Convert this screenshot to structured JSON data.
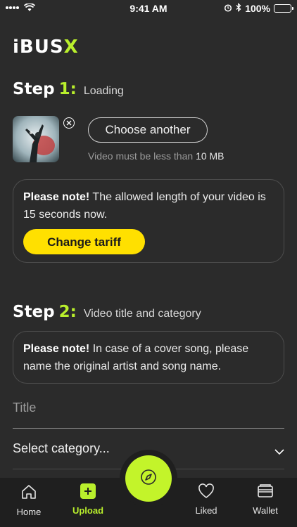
{
  "status_bar": {
    "time": "9:41 AM",
    "battery": "100%"
  },
  "logo": {
    "main": "iBUS",
    "accent": "X"
  },
  "step1": {
    "word": "Step",
    "num": "1:",
    "subtitle": "Loading"
  },
  "upload": {
    "choose_label": "Choose another",
    "size_note_prefix": "Video must be less than",
    "size_note_value": "10 MB"
  },
  "note1": {
    "strong": "Please note!",
    "text": " The allowed length of your video is 15 seconds now.",
    "button": "Change tariff"
  },
  "step2": {
    "word": "Step",
    "num": "2:",
    "subtitle": "Video title and category"
  },
  "note2": {
    "strong": "Please note!",
    "text": " In case of a cover song, please name the original artist and song name."
  },
  "form": {
    "title_placeholder": "Title",
    "category_placeholder": "Select category..."
  },
  "tabs": [
    {
      "label": "Home",
      "icon": "home-icon"
    },
    {
      "label": "Upload",
      "icon": "plus-icon"
    },
    {
      "label": "Liked",
      "icon": "heart-icon"
    },
    {
      "label": "Wallet",
      "icon": "wallet-icon"
    }
  ],
  "fab": {
    "icon": "compass-icon"
  },
  "colors": {
    "accent": "#b9ef2c",
    "button": "#ffe000",
    "background": "#2b2b2b"
  }
}
